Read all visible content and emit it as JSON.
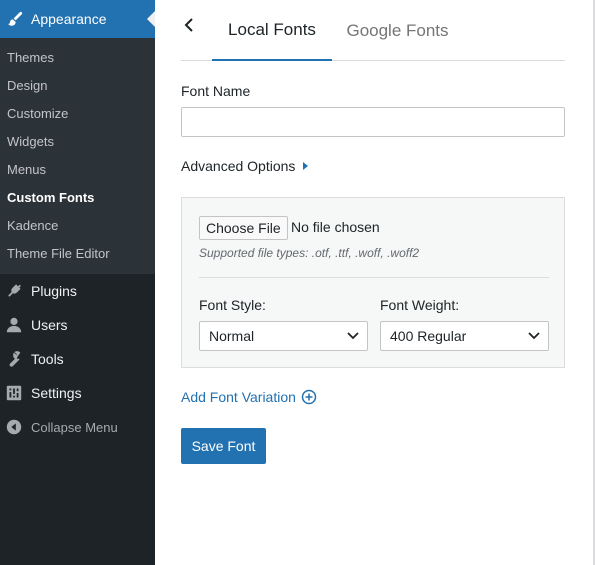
{
  "sidebar": {
    "active_menu": {
      "label": "Appearance",
      "icon": "paintbrush-icon"
    },
    "submenu": [
      {
        "label": "Themes"
      },
      {
        "label": "Design"
      },
      {
        "label": "Customize"
      },
      {
        "label": "Widgets"
      },
      {
        "label": "Menus"
      },
      {
        "label": "Custom Fonts",
        "current": true
      },
      {
        "label": "Kadence"
      },
      {
        "label": "Theme File Editor"
      }
    ],
    "menu": [
      {
        "label": "Plugins",
        "icon": "plugin-icon"
      },
      {
        "label": "Users",
        "icon": "users-icon"
      },
      {
        "label": "Tools",
        "icon": "wrench-icon"
      },
      {
        "label": "Settings",
        "icon": "settings-icon"
      },
      {
        "label": "Collapse Menu",
        "icon": "collapse-icon"
      }
    ]
  },
  "tabs": {
    "back_icon": "chevron-left-icon",
    "local": "Local Fonts",
    "google": "Google Fonts",
    "active": "Local Fonts"
  },
  "form": {
    "font_name_label": "Font Name",
    "font_name_value": "",
    "advanced_options": "Advanced Options",
    "choose_file": "Choose File",
    "no_file": "No file chosen",
    "supported_types": "Supported file types: .otf, .ttf, .woff, .woff2",
    "font_style_label": "Font Style:",
    "font_style_value": "Normal",
    "font_weight_label": "Font Weight:",
    "font_weight_value": "400 Regular",
    "add_variation": "Add Font Variation",
    "save_button": "Save Font"
  },
  "colors": {
    "accent": "#2271b1",
    "sidebar_bg": "#1d2327",
    "submenu_bg": "#2c3338"
  }
}
